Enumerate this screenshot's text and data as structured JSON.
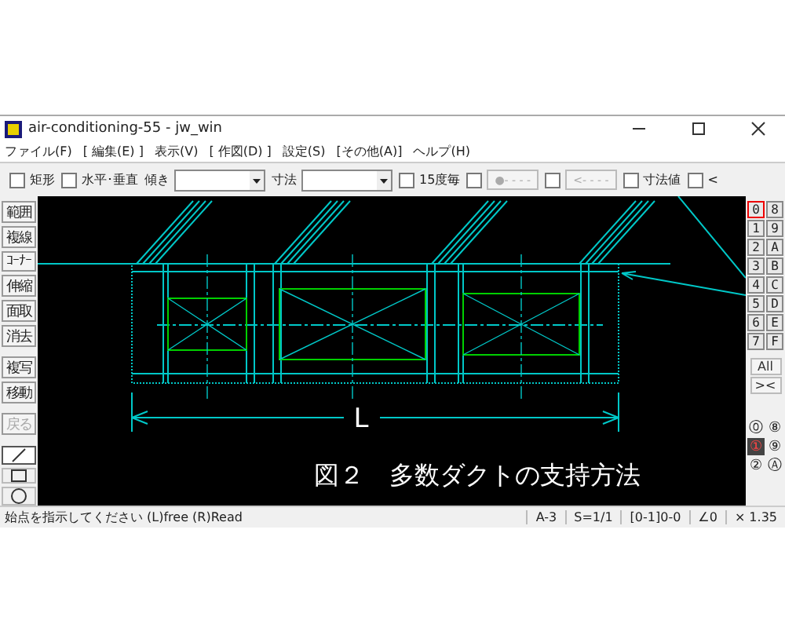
{
  "window": {
    "title": "air-conditioning-55 - jw_win"
  },
  "menu": [
    "ファイル(F)",
    "[ 編集(E) ]",
    "表示(V)",
    "[ 作図(D) ]",
    "設定(S)",
    "[その他(A)]",
    "ヘルプ(H)"
  ],
  "toolbar": [
    {
      "kind": "checkbox",
      "label": "矩形",
      "checked": false
    },
    {
      "kind": "checkbox",
      "label": "水平･垂直",
      "checked": false
    },
    {
      "kind": "select",
      "label": "傾き"
    },
    {
      "kind": "select",
      "label": "寸法"
    },
    {
      "kind": "checkbox",
      "label": "15度毎",
      "checked": false
    },
    {
      "kind": "checkbutton",
      "label": "●- - - -",
      "checked": false,
      "disabled": true
    },
    {
      "kind": "checkbutton",
      "label": "<- - - -",
      "checked": false,
      "disabled": true
    },
    {
      "kind": "checkbox",
      "label": "寸法値",
      "checked": false
    },
    {
      "kind": "checkbox",
      "label": "<",
      "checked": false
    }
  ],
  "left_tools": [
    {
      "label": "範囲",
      "disabled": false
    },
    {
      "label": "複線",
      "disabled": false
    },
    {
      "label": "ｺｰﾅｰ",
      "disabled": false
    },
    {
      "label": "伸縮",
      "disabled": false
    },
    {
      "label": "面取",
      "disabled": false
    },
    {
      "label": "消去",
      "disabled": false
    },
    {
      "label": "複写",
      "disabled": false
    },
    {
      "label": "移動",
      "disabled": false
    },
    {
      "label": "戻る",
      "disabled": true
    }
  ],
  "draw_tools": [
    {
      "kind": "line",
      "selected": true
    },
    {
      "kind": "rectangle",
      "selected": false
    },
    {
      "kind": "circle",
      "selected": false
    }
  ],
  "canvas": {
    "dimension_label": "L",
    "caption": "図２　多数ダクトの支持方法"
  },
  "layers": [
    {
      "label": "0",
      "selected": true
    },
    {
      "label": "8",
      "selected": false
    },
    {
      "label": "1",
      "selected": false
    },
    {
      "label": "9",
      "selected": false
    },
    {
      "label": "2",
      "selected": false
    },
    {
      "label": "A",
      "selected": false
    },
    {
      "label": "3",
      "selected": false
    },
    {
      "label": "B",
      "selected": false
    },
    {
      "label": "4",
      "selected": false
    },
    {
      "label": "C",
      "selected": false
    },
    {
      "label": "5",
      "selected": false
    },
    {
      "label": "D",
      "selected": false
    },
    {
      "label": "6",
      "selected": false
    },
    {
      "label": "E",
      "selected": false
    },
    {
      "label": "7",
      "selected": false
    },
    {
      "label": "F",
      "selected": false
    }
  ],
  "layer_buttons": [
    "All",
    "><"
  ],
  "layer_groups": [
    {
      "label": "⓪",
      "selected": false
    },
    {
      "label": "⑧",
      "selected": false
    },
    {
      "label": "①",
      "selected": true
    },
    {
      "label": "⑨",
      "selected": false
    },
    {
      "label": "②",
      "selected": false
    },
    {
      "label": "Ⓐ",
      "selected": false
    }
  ],
  "status_bar": {
    "message": "始点を指示してください (L)free (R)Read",
    "cells": [
      "A-3",
      "S=1/1",
      "[0-1]0-0",
      "∠0",
      "× 1.35"
    ]
  }
}
